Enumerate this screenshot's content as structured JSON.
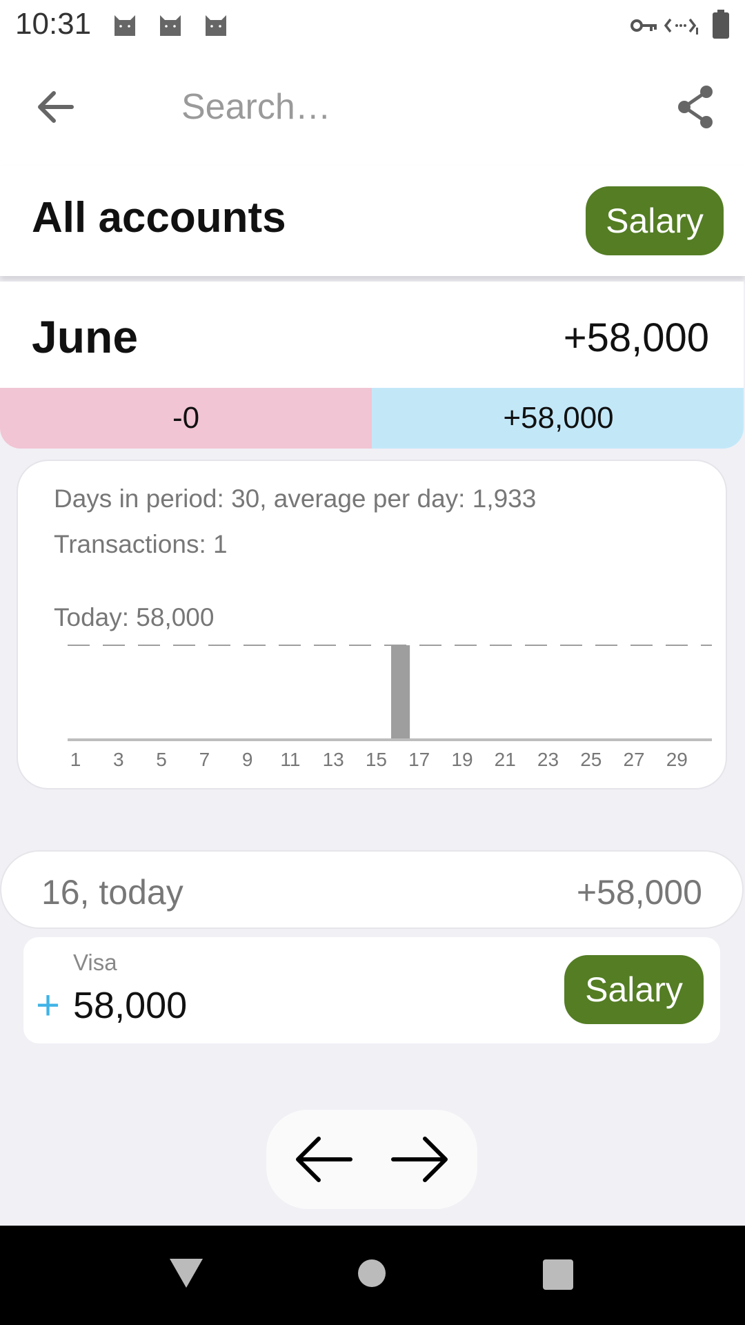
{
  "status_bar": {
    "time": "10:31",
    "notification_icons": [
      "cat-icon",
      "cat-icon",
      "cat-icon"
    ],
    "right_icons": [
      "vpn-key-icon",
      "data-sync-icon",
      "battery-icon"
    ]
  },
  "toolbar": {
    "back_icon": "arrow-left-icon",
    "search_placeholder": "Search…",
    "share_icon": "share-icon"
  },
  "header": {
    "title": "All accounts",
    "category_chip": "Salary"
  },
  "month": {
    "name": "June",
    "total": "+58,000",
    "expenses": "-0",
    "income": "+58,000"
  },
  "stats": {
    "days_line": "Days in period: 30,  average per day: 1,933",
    "transactions_line": "Transactions: 1",
    "today_line": "Today: 58,000"
  },
  "chart_data": {
    "type": "bar",
    "x_tick_labels": [
      "1",
      "3",
      "5",
      "7",
      "9",
      "11",
      "13",
      "15",
      "17",
      "19",
      "21",
      "23",
      "25",
      "27",
      "29"
    ],
    "days": 30,
    "values": [
      0,
      0,
      0,
      0,
      0,
      0,
      0,
      0,
      0,
      0,
      0,
      0,
      0,
      0,
      0,
      58000,
      0,
      0,
      0,
      0,
      0,
      0,
      0,
      0,
      0,
      0,
      0,
      0,
      0,
      0
    ],
    "reference_line": 58000,
    "ylim": [
      0,
      58000
    ],
    "colors": {
      "bar": "#9e9e9e",
      "axis": "#bdbdbd",
      "reference": "#9e9e9e"
    }
  },
  "day_group": {
    "label": "16, today",
    "total": "+58,000"
  },
  "transaction": {
    "account": "Visa",
    "sign": "+",
    "amount": "58,000",
    "category": "Salary"
  },
  "pager": {
    "prev_icon": "arrow-left-icon",
    "next_icon": "arrow-right-icon"
  },
  "system_nav": [
    "back-triangle-icon",
    "home-circle-icon",
    "recents-square-icon"
  ],
  "colors": {
    "accent_green": "#547d24",
    "expense_band": "#f1c5d3",
    "income_band": "#c2e8f8",
    "plus_blue": "#3fb3e6"
  }
}
